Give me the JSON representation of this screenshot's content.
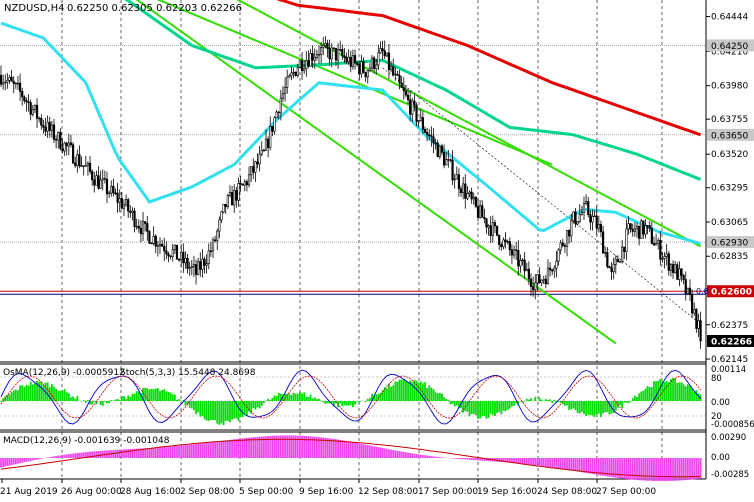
{
  "window": {
    "symbol_header": "NZDUSD,H4",
    "ohlc_header": "0.62250 0.62305 0.62203 0.62266"
  },
  "colors": {
    "background": "#ffffff",
    "candle": "#000000",
    "ma_fast": "#33e0f0",
    "ma_mid": "#00d68a",
    "ma_slow": "#e60000",
    "channel": "#33dd00",
    "level_line_red": "#cc0000",
    "level_line_blue": "#000080",
    "price_label_bg": "#c8c8c8",
    "current_price_bg": "#000000",
    "hist_green": "#00dd00",
    "hist_magenta": "#ee44ee",
    "stoch_main": "#0000cc",
    "stoch_signal": "#cc0000",
    "macd_signal": "#cc0000",
    "grid": "#000000"
  },
  "price_axis": {
    "ticks": [
      "0.64444",
      "0.64210",
      "0.63980",
      "0.63755",
      "0.63520",
      "0.63295",
      "0.63065",
      "0.62835",
      "0.62605",
      "0.62375",
      "0.62145"
    ],
    "marked_levels": [
      "0.64250",
      "0.63650",
      "0.62930",
      "0.62600"
    ],
    "current_price": "0.62266",
    "range": [
      0.62145,
      0.64444
    ]
  },
  "time_axis": {
    "labels": [
      "21 Aug 2019",
      "26 Aug 00:00",
      "28 Aug 16:00",
      "2 Sep 08:00",
      "5 Sep 00:00",
      "9 Sep 16:00",
      "12 Sep 08:00",
      "17 Sep 00:00",
      "19 Sep 16:00",
      "24 Sep 08:00",
      "27 Sep 00:00"
    ]
  },
  "osma_panel": {
    "label": "OsMA(12,26,9) -0.0005912",
    "stoch_label": "Stoch(5,3,3) 15.5448 24.8698",
    "ticks": [
      "0.00114",
      "80",
      "0.00",
      "20",
      "-0.000856"
    ]
  },
  "macd_panel": {
    "label": "MACD(12,26,9) -0.001639 -0.001048",
    "ticks": [
      "0.00290",
      "0.00",
      "-0.00285"
    ]
  },
  "level_tags": {
    "zero_marker": "0.0"
  },
  "chart_data": {
    "type": "candlestick",
    "symbol": "NZDUSD",
    "timeframe": "H4",
    "last_bar": {
      "open": 0.6225,
      "high": 0.62305,
      "low": 0.62203,
      "close": 0.62266
    },
    "horizontal_levels": [
      0.6425,
      0.6365,
      0.6293,
      0.626
    ],
    "price_anchors": [
      [
        0,
        0.6405
      ],
      [
        10,
        0.6392
      ],
      [
        20,
        0.6372
      ],
      [
        32,
        0.6355
      ],
      [
        45,
        0.6335
      ],
      [
        58,
        0.6318
      ],
      [
        68,
        0.63
      ],
      [
        82,
        0.6285
      ],
      [
        92,
        0.6272
      ],
      [
        100,
        0.629
      ],
      [
        106,
        0.6318
      ],
      [
        114,
        0.633
      ],
      [
        124,
        0.6352
      ],
      [
        132,
        0.639
      ],
      [
        140,
        0.6412
      ],
      [
        150,
        0.6422
      ],
      [
        160,
        0.6418
      ],
      [
        172,
        0.6408
      ],
      [
        180,
        0.642
      ],
      [
        186,
        0.6402
      ],
      [
        194,
        0.6382
      ],
      [
        204,
        0.636
      ],
      [
        214,
        0.6338
      ],
      [
        224,
        0.6315
      ],
      [
        234,
        0.6298
      ],
      [
        244,
        0.628
      ],
      [
        252,
        0.6265
      ],
      [
        258,
        0.6272
      ],
      [
        264,
        0.629
      ],
      [
        270,
        0.6308
      ],
      [
        276,
        0.6315
      ],
      [
        282,
        0.6302
      ],
      [
        288,
        0.627
      ],
      [
        296,
        0.63
      ],
      [
        304,
        0.6302
      ],
      [
        312,
        0.6285
      ],
      [
        320,
        0.627
      ],
      [
        326,
        0.625
      ],
      [
        330,
        0.623
      ]
    ],
    "series": [
      {
        "name": "MA fast",
        "color": "#33e0f0",
        "points": [
          [
            0,
            0.644
          ],
          [
            20,
            0.643
          ],
          [
            40,
            0.64
          ],
          [
            55,
            0.635
          ],
          [
            70,
            0.632
          ],
          [
            90,
            0.633
          ],
          [
            110,
            0.6345
          ],
          [
            130,
            0.6375
          ],
          [
            150,
            0.64
          ],
          [
            180,
            0.6395
          ],
          [
            200,
            0.6365
          ],
          [
            230,
            0.633
          ],
          [
            255,
            0.63
          ],
          [
            275,
            0.6315
          ],
          [
            290,
            0.6313
          ],
          [
            310,
            0.63
          ],
          [
            330,
            0.6292
          ]
        ]
      },
      {
        "name": "MA mid",
        "color": "#00d68a",
        "points": [
          [
            0,
            0.648
          ],
          [
            30,
            0.648
          ],
          [
            60,
            0.6455
          ],
          [
            90,
            0.6425
          ],
          [
            120,
            0.641
          ],
          [
            150,
            0.6412
          ],
          [
            180,
            0.6415
          ],
          [
            210,
            0.6395
          ],
          [
            240,
            0.637
          ],
          [
            270,
            0.6365
          ],
          [
            300,
            0.6352
          ],
          [
            330,
            0.6335
          ]
        ]
      },
      {
        "name": "MA slow",
        "color": "#e60000",
        "points": [
          [
            0,
            0.6495
          ],
          [
            60,
            0.649
          ],
          [
            100,
            0.647
          ],
          [
            140,
            0.6452
          ],
          [
            180,
            0.6445
          ],
          [
            220,
            0.6425
          ],
          [
            260,
            0.64
          ],
          [
            300,
            0.638
          ],
          [
            330,
            0.6365
          ]
        ]
      }
    ],
    "channel_lines": [
      {
        "points": [
          [
            0,
            0.65
          ],
          [
            260,
            0.6345
          ]
        ]
      },
      {
        "points": [
          [
            60,
            0.6495
          ],
          [
            330,
            0.629
          ]
        ]
      },
      {
        "points": [
          [
            55,
            0.6465
          ],
          [
            290,
            0.6225
          ]
        ]
      }
    ]
  }
}
